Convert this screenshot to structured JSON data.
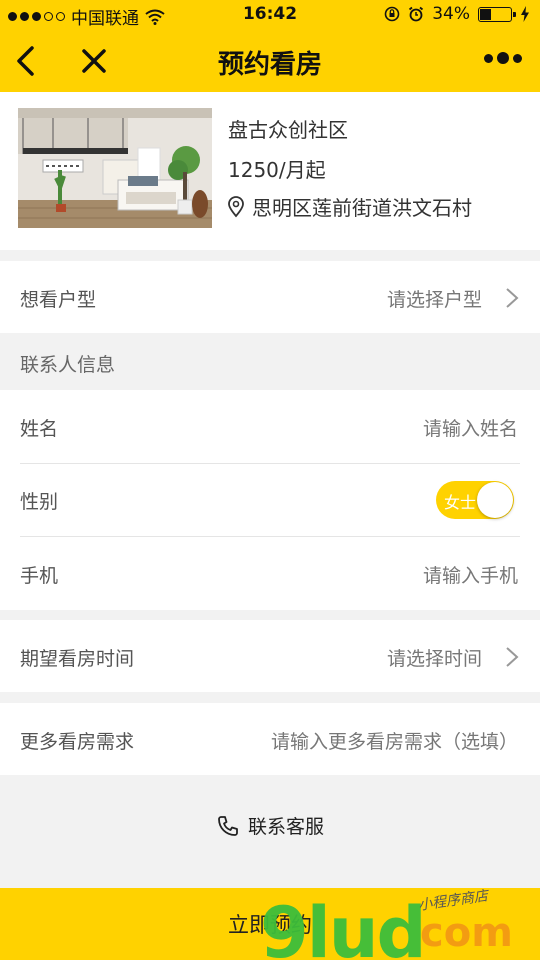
{
  "status": {
    "carrier": "中国联通",
    "time": "16:42",
    "battery": "34%",
    "battery_level": 0.34
  },
  "nav": {
    "title": "预约看房"
  },
  "listing": {
    "name": "盘古众创社区",
    "price": "1250/月起",
    "address": "思明区莲前街道洪文石村"
  },
  "room_type": {
    "label": "想看户型",
    "value": "请选择户型"
  },
  "contact": {
    "header": "联系人信息",
    "name_label": "姓名",
    "name_placeholder": "请输入姓名",
    "gender_label": "性别",
    "gender_value": "女士",
    "phone_label": "手机",
    "phone_placeholder": "请输入手机"
  },
  "visit_time": {
    "label": "期望看房时间",
    "value": "请选择时间"
  },
  "more": {
    "label": "更多看房需求",
    "placeholder": "请输入更多看房需求（选填）"
  },
  "service": {
    "label": "联系客服"
  },
  "submit": {
    "label": "立即预约"
  },
  "watermark": {
    "brand": "9lud",
    "suffix": "com",
    "tagline": "小程序商店"
  },
  "colors": {
    "accent": "#ffd200",
    "background": "#f2f2f2"
  }
}
